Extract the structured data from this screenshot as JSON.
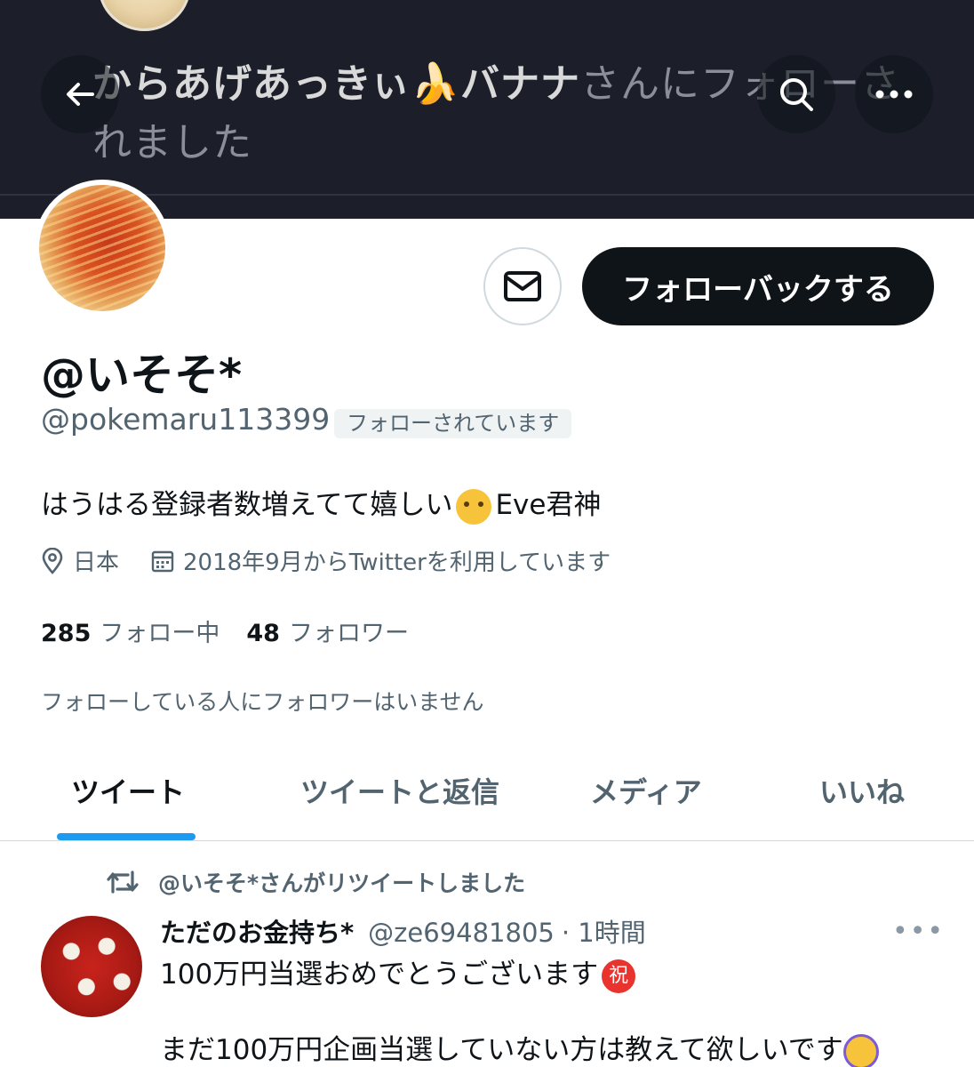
{
  "banner": {
    "notification_bold": "からあげあっきぃ",
    "notification_name2": "バナナ",
    "notification_rest": "さんにフォローさ",
    "notification_line2": "れました"
  },
  "profile": {
    "display_name": "@いそそ*",
    "handle": "@pokemaru113399",
    "follows_you": "フォローされています",
    "follow_back": "フォローバックする",
    "bio_text": "はうはる登録者数増えてて嬉しい",
    "bio_tail": "Eve君神",
    "location": "日本",
    "joined": "2018年9月からTwitterを利用しています",
    "following_count": "285",
    "following_label": "フォロー中",
    "followers_count": "48",
    "followers_label": "フォロワー",
    "mutual_note": "フォローしている人にフォロワーはいません"
  },
  "tabs": [
    {
      "label": "ツイート"
    },
    {
      "label": "ツイートと返信"
    },
    {
      "label": "メディア"
    },
    {
      "label": "いいね"
    }
  ],
  "tweet": {
    "retweet_label": "@いそそ*さんがリツイートしました",
    "author": "ただのお金持ち*",
    "handle": "@ze69481805",
    "time": "· 1時間",
    "more": "•••",
    "line1": "100万円当選おめでとうございます",
    "badge": "祝",
    "line2": "まだ100万円企画当選していない方は教えて欲しいです"
  },
  "colors": {
    "accent": "#1d9bf0",
    "banner_bg": "#1c1f2a",
    "secondary_text": "#536471"
  }
}
